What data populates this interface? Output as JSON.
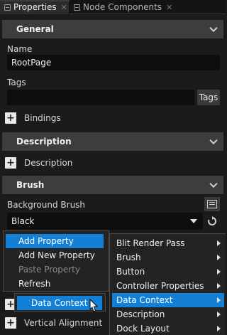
{
  "tabs": [
    {
      "label": "Properties"
    },
    {
      "label": "Node Components"
    }
  ],
  "sections": {
    "general": "General",
    "description": "Description",
    "brush": "Brush"
  },
  "general": {
    "name_label": "Name",
    "name_value": "RootPage",
    "tags_label": "Tags",
    "tags_value": "",
    "tags_button": "Tags",
    "bindings_label": "Bindings"
  },
  "description": {
    "description_label": "Description"
  },
  "brush": {
    "background_label": "Background Brush",
    "background_value": "Black"
  },
  "context_menu": {
    "items": [
      {
        "label": "Add Property",
        "highlighted": true,
        "disabled": false
      },
      {
        "label": "Add New Property",
        "highlighted": false,
        "disabled": false
      },
      {
        "label": "Paste Property",
        "highlighted": false,
        "disabled": true
      },
      {
        "label": "Refresh",
        "highlighted": false,
        "disabled": false
      }
    ]
  },
  "sub_menu": {
    "item": "Data Context"
  },
  "property_menu": {
    "items": [
      {
        "label": "Blit Render Pass",
        "highlighted": false
      },
      {
        "label": "Brush",
        "highlighted": false
      },
      {
        "label": "Button",
        "highlighted": false
      },
      {
        "label": "Controller Properties",
        "highlighted": false
      },
      {
        "label": "Data Context",
        "highlighted": true
      },
      {
        "label": "Description",
        "highlighted": false
      },
      {
        "label": "Dock Layout",
        "highlighted": false
      }
    ]
  },
  "background_rows": {
    "vertical_alignment": "Vertical Alignment"
  },
  "colors": {
    "highlight": "#1380d6",
    "section_bg": "#3d3d3d",
    "panel_bg": "#1b1b1b"
  }
}
